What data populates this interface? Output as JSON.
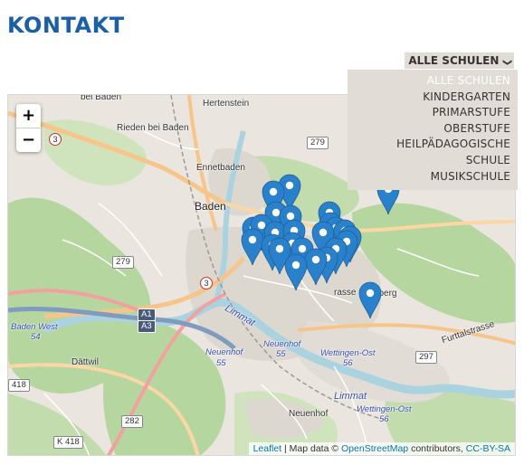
{
  "page": {
    "title": "KONTAKT"
  },
  "filter": {
    "label": "ALLE SCHULEN",
    "options": [
      {
        "label": "ALLE SCHULEN",
        "active": true
      },
      {
        "label": "KINDERGARTEN",
        "active": false
      },
      {
        "label": "PRIMARSTUFE",
        "active": false
      },
      {
        "label": "OBERSTUFE",
        "active": false
      },
      {
        "label": "HEILPÄDAGOGISCHE SCHULE",
        "active": false
      },
      {
        "label": "MUSIKSCHULE",
        "active": false
      }
    ]
  },
  "map": {
    "zoom_in": "+",
    "zoom_out": "−",
    "attribution": {
      "leaflet": "Leaflet",
      "sep": " | Map data © ",
      "osm": "OpenStreetMap",
      "contrib": " contributors, ",
      "license": "CC-BY-SA"
    },
    "labels": {
      "bei_baden": "bei Baden",
      "hertenstein": "Hertenstein",
      "rieden": "Rieden bei Baden",
      "ennetbaden": "Ennetbaden",
      "baden": "Baden",
      "baden_center": "den",
      "sulperg": "Sulperg",
      "furttal": "Furttalstrasse",
      "strasse": "rasse",
      "baden_west": "Baden West",
      "neuenhof_station": "Neuenhof",
      "neuenhof_station2": "Neuenhof",
      "wettingen_ost": "Wettingen-Ost",
      "wettingen_ost2": "Wettingen-Ost",
      "dattwil": "Dättwil",
      "neuenhof": "Neuenhof",
      "limmat": "Limmat",
      "limmat2": "Limmat"
    },
    "road_badges": {
      "r3a": "3",
      "r3b": "3",
      "r279a": "279",
      "r279b": "279",
      "r297": "297",
      "r418": "418",
      "r282": "282",
      "rk418": "K 418",
      "a1": "A1",
      "a3": "A3",
      "n54": "54",
      "n55a": "55",
      "n55b": "55",
      "n56a": "56",
      "n56b": "56"
    },
    "marker_color": "#2a81cb",
    "marker_count": 26
  },
  "colors": {
    "brand": "#1b5fa6",
    "forest": "#b6d6a0",
    "urban": "#ddd8cf",
    "water": "#aad3df"
  }
}
